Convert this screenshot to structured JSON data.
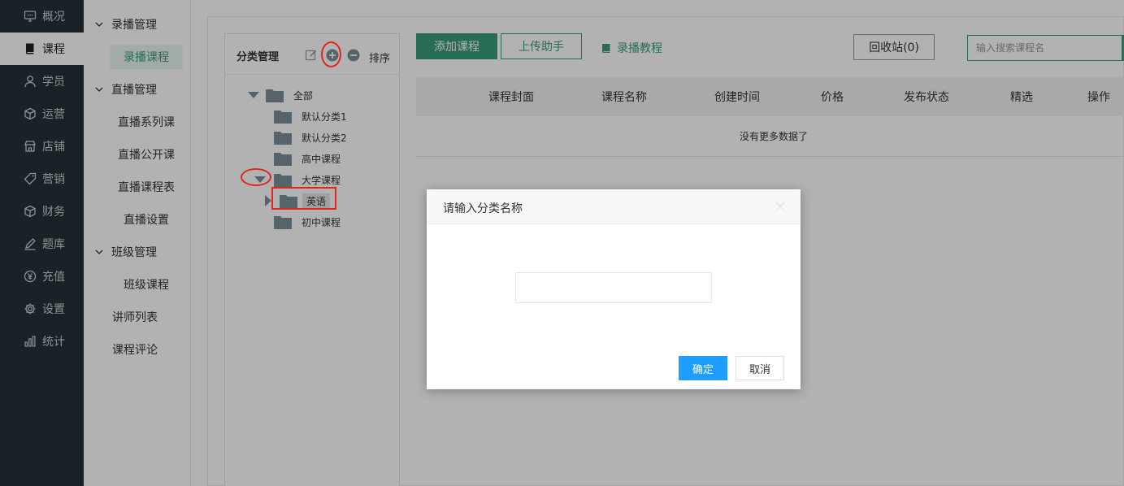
{
  "nav": {
    "items": [
      {
        "label": "概况",
        "icon": "monitor-chat-icon"
      },
      {
        "label": "课程",
        "icon": "book-icon"
      },
      {
        "label": "学员",
        "icon": "user-icon"
      },
      {
        "label": "运营",
        "icon": "cube-icon"
      },
      {
        "label": "店铺",
        "icon": "store-icon"
      },
      {
        "label": "营销",
        "icon": "tag-icon"
      },
      {
        "label": "财务",
        "icon": "cube-icon"
      },
      {
        "label": "题库",
        "icon": "pen-icon"
      },
      {
        "label": "充值",
        "icon": "yen-icon"
      },
      {
        "label": "设置",
        "icon": "gear-icon"
      },
      {
        "label": "统计",
        "icon": "bar-chart-icon"
      }
    ],
    "active": "课程"
  },
  "subnav": {
    "group_record": "录播管理",
    "record_course": "录播课程",
    "group_live": "直播管理",
    "live_series": "直播系列课",
    "live_public": "直播公开课",
    "live_schedule": "直播课程表",
    "live_settings": "直播设置",
    "group_class": "班级管理",
    "class_course": "班级课程",
    "teacher_list": "讲师列表",
    "course_review": "课程评论"
  },
  "category": {
    "title": "分类管理",
    "sort_label": "排序",
    "tree": {
      "root": "全部",
      "default1": "默认分类1",
      "default2": "默认分类2",
      "highschool": "高中课程",
      "university": "大学课程",
      "english": "英语",
      "middleschool": "初中课程"
    }
  },
  "toolbar": {
    "add_course": "添加课程",
    "upload_helper": "上传助手",
    "tutorial": "录播教程",
    "recycle": "回收站(0)",
    "search_placeholder": "输入搜索课程名"
  },
  "table": {
    "columns": {
      "cover": "课程封面",
      "name": "课程名称",
      "created": "创建时间",
      "price": "价格",
      "status": "发布状态",
      "featured": "精选",
      "actions": "操作"
    },
    "empty": "没有更多数据了"
  },
  "dialog": {
    "title": "请输入分类名称",
    "input_value": "",
    "ok": "确定",
    "cancel": "取消"
  },
  "colors": {
    "brand": "#3a9a7b",
    "nav_bg": "#263238",
    "confirm": "#1e9fff",
    "annotation": "#e1251b"
  }
}
